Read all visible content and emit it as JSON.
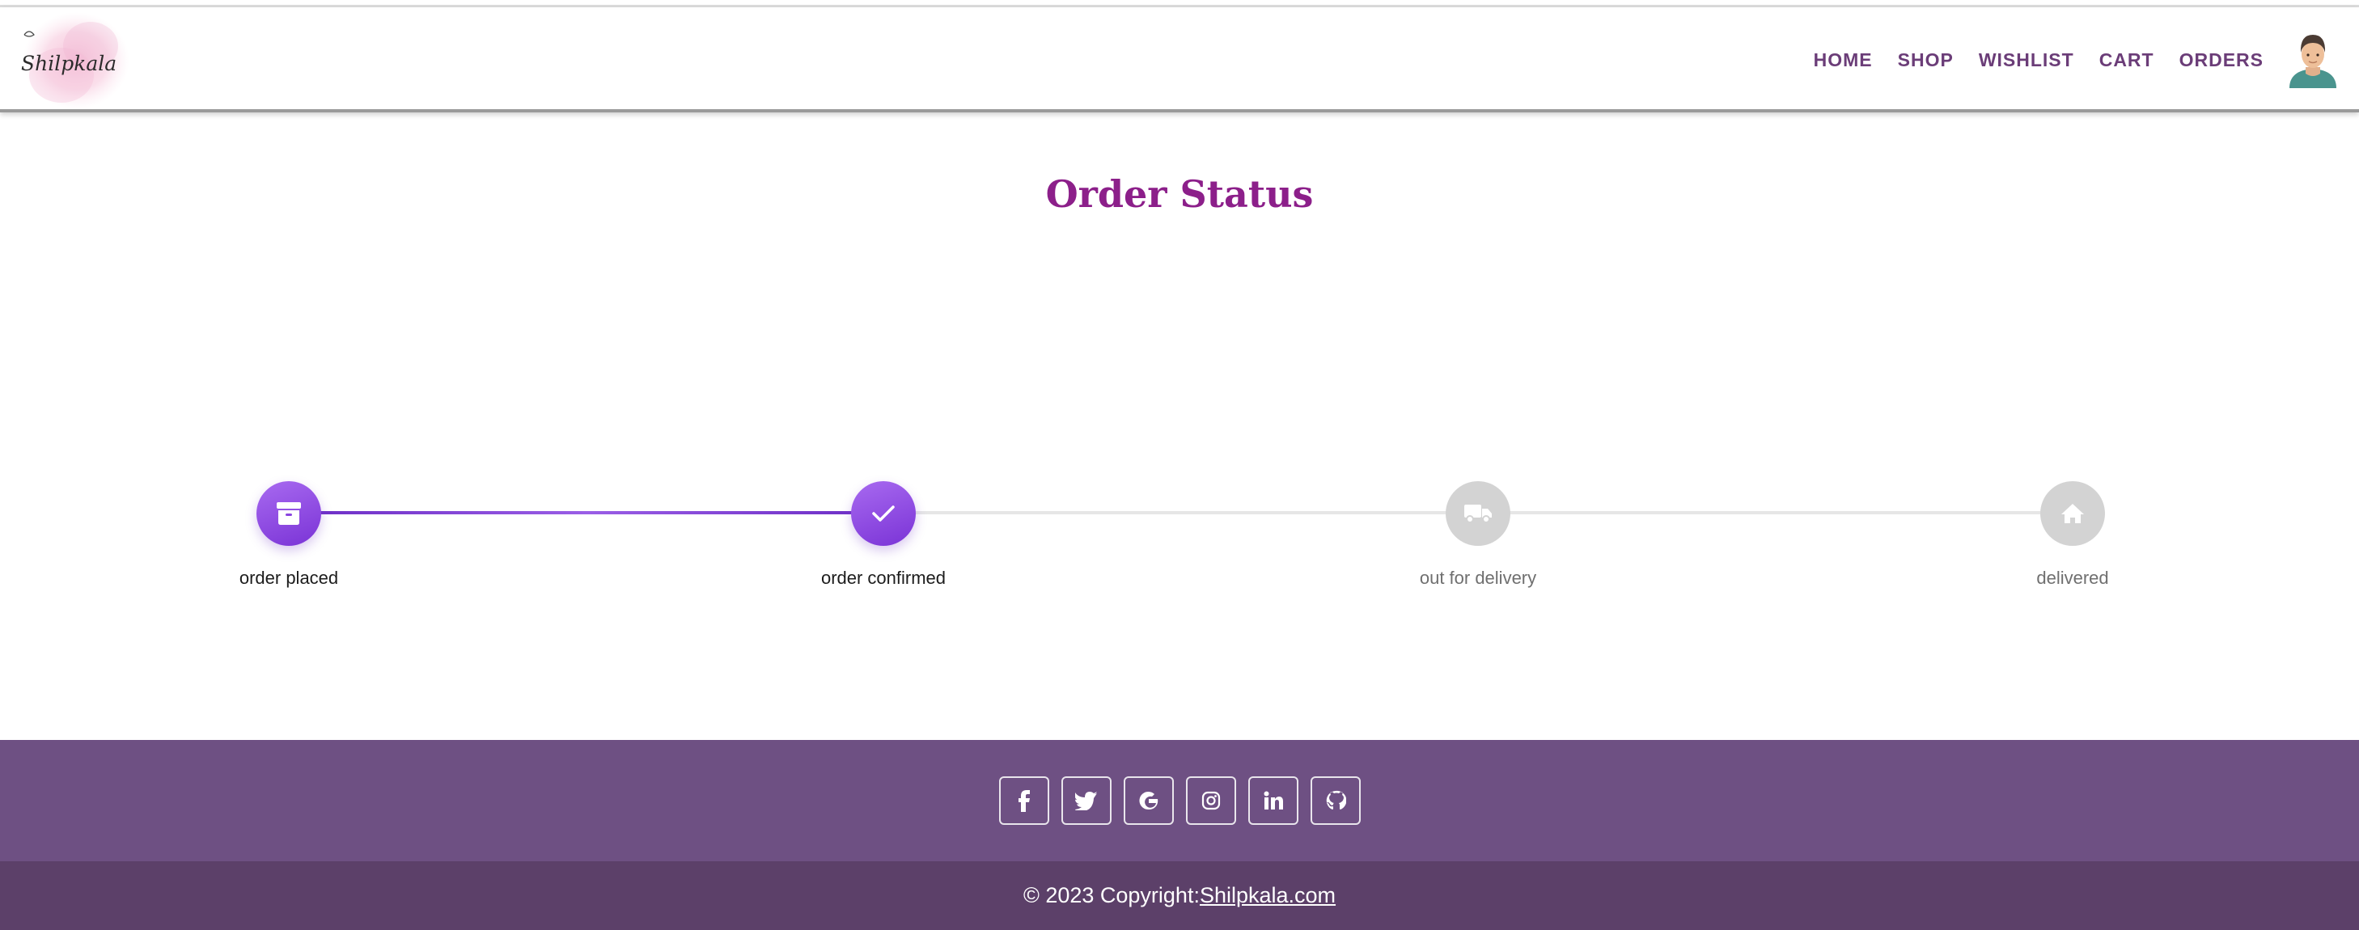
{
  "brand": {
    "logo_text": "Shilpkala"
  },
  "nav": {
    "items": [
      {
        "label": "HOME"
      },
      {
        "label": "SHOP"
      },
      {
        "label": "WISHLIST"
      },
      {
        "label": "CART"
      },
      {
        "label": "ORDERS"
      }
    ],
    "avatar_icon": "user-avatar-icon"
  },
  "page": {
    "title": "Order Status"
  },
  "tracker": {
    "steps": [
      {
        "label": "order placed",
        "icon": "archive-box-icon",
        "status": "complete"
      },
      {
        "label": "order confirmed",
        "icon": "check-icon",
        "status": "complete"
      },
      {
        "label": "out for delivery",
        "icon": "truck-icon",
        "status": "pending"
      },
      {
        "label": "delivered",
        "icon": "home-icon",
        "status": "pending"
      }
    ]
  },
  "footer": {
    "socials": [
      {
        "icon": "facebook-icon"
      },
      {
        "icon": "twitter-icon"
      },
      {
        "icon": "google-icon"
      },
      {
        "icon": "instagram-icon"
      },
      {
        "icon": "linkedin-icon"
      },
      {
        "icon": "github-icon"
      }
    ],
    "copyright_prefix": "© 2023 Copyright:",
    "copyright_link": "Shilpkala.com"
  },
  "colors": {
    "accent": "#8c1f8a",
    "nav_text": "#6b3d78",
    "step_active": "#8a44e0",
    "step_pending": "#d3d3d3",
    "footer_top": "#6e5083",
    "footer_bottom": "#5c4069"
  }
}
